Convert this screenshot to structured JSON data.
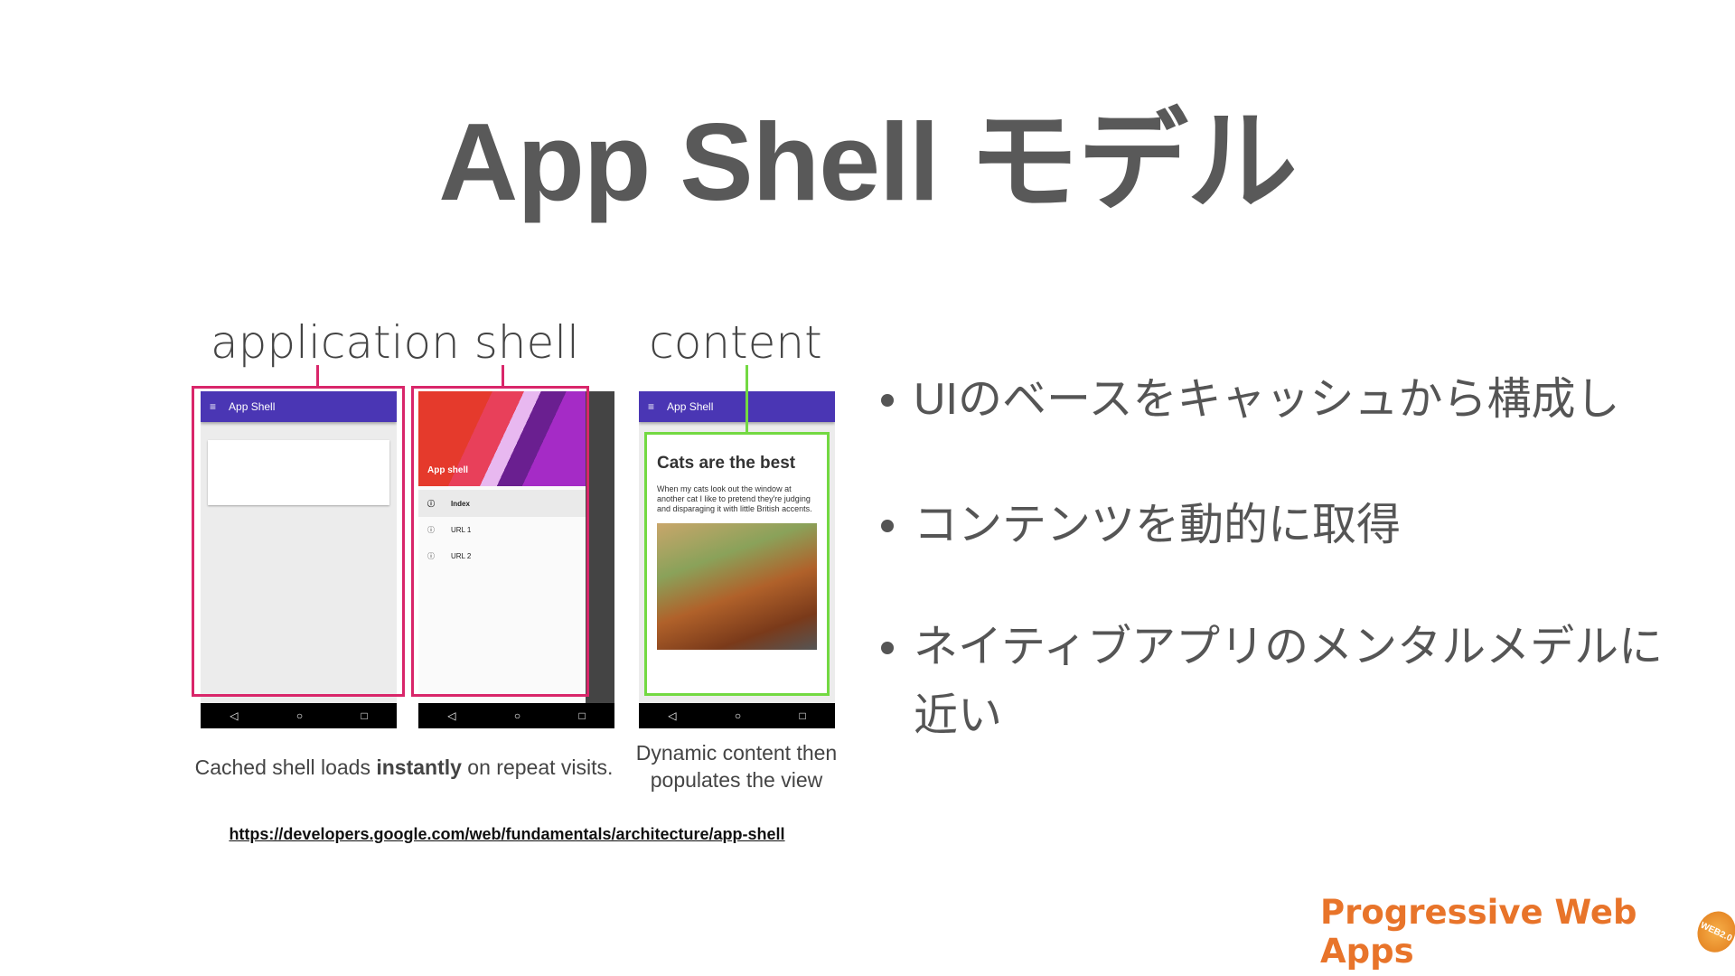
{
  "title": "App Shell モデル",
  "labels": {
    "shell": "application shell",
    "content": "content"
  },
  "phone1": {
    "header": "App Shell"
  },
  "phone2": {
    "banner": "App shell",
    "items": [
      "Index",
      "URL 1",
      "URL 2"
    ]
  },
  "phone3": {
    "header": "App Shell",
    "card_title": "Cats are the best",
    "card_text": "When my cats look out the window at another cat I like to pretend they're judging and disparaging it with little British accents."
  },
  "nav_icons": [
    "back-icon",
    "home-icon",
    "recents-icon"
  ],
  "captions": {
    "shell_pre": "Cached shell loads ",
    "shell_bold": "instantly",
    "shell_post": " on repeat visits.",
    "content_line1": "Dynamic content then",
    "content_line2": "populates the view"
  },
  "link": "https://developers.google.com/web/fundamentals/architecture/app-shell",
  "bullets": [
    "UIのベースをキャッシュから構成し",
    "コンテンツを動的に取得",
    "ネイティブアプリのメンタルメデルに近い"
  ],
  "logo": {
    "text": "Progressive Web Apps",
    "badge": "WEB2.0"
  },
  "colors": {
    "shell_box": "#d9266a",
    "content_box": "#73d942",
    "app_bar": "#4a36b4",
    "logo": "#e8742a"
  }
}
